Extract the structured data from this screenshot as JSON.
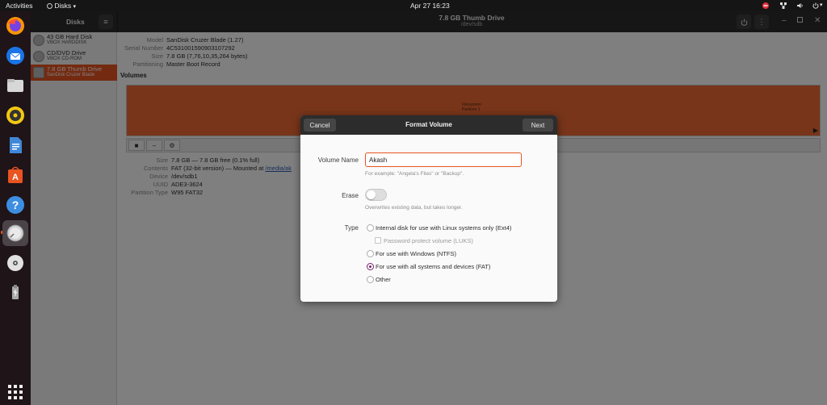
{
  "topbar": {
    "activities": "Activities",
    "app_menu": "Disks",
    "clock": "Apr 27  16:23"
  },
  "dock": {
    "items": [
      {
        "name": "firefox",
        "icon": "firefox-icon"
      },
      {
        "name": "thunderbird",
        "icon": "mail-icon"
      },
      {
        "name": "files",
        "icon": "folder-icon"
      },
      {
        "name": "rhythmbox",
        "icon": "music-icon"
      },
      {
        "name": "libreoffice-writer",
        "icon": "document-icon"
      },
      {
        "name": "software",
        "icon": "app-store-icon"
      },
      {
        "name": "help",
        "icon": "help-icon"
      },
      {
        "name": "disks",
        "icon": "disks-icon",
        "active": true
      },
      {
        "name": "cd-drive",
        "icon": "disc-icon"
      },
      {
        "name": "usb-drive",
        "icon": "usb-icon"
      },
      {
        "name": "show-applications",
        "icon": "grid-icon"
      }
    ]
  },
  "header": {
    "sidebar_title": "Disks",
    "title": "7.8 GB Thumb Drive",
    "subtitle": "/dev/sdb"
  },
  "sidebar": {
    "drives": [
      {
        "name": "43 GB Hard Disk",
        "sub": "VBOX HARDDISK"
      },
      {
        "name": "CD/DVD Drive",
        "sub": "VBOX CD-ROM"
      },
      {
        "name": "7.8 GB Thumb Drive",
        "sub": "SanDisk Cruzer Blade",
        "selected": true
      }
    ]
  },
  "drive_info": {
    "model_label": "Model",
    "model": "SanDisk Cruzer Blade (1.27)",
    "serial_label": "Serial Number",
    "serial": "4C531001590903107292",
    "size_label": "Size",
    "size": "7.8 GB (7,76,10,35,264 bytes)",
    "partitioning_label": "Partitioning",
    "partitioning": "Master Boot Record"
  },
  "volumes": {
    "heading": "Volumes",
    "bar_text_1": "Filesystem",
    "bar_text_2": "Partition 1"
  },
  "partition_info": {
    "size_label": "Size",
    "size": "7.8 GB — 7.8 GB free (0.1% full)",
    "contents_label": "Contents",
    "contents": "FAT (32-bit version) — Mounted at ",
    "mount_link": "/media/ak",
    "device_label": "Device",
    "device": "/dev/sdb1",
    "uuid_label": "UUID",
    "uuid": "ADE3-3624",
    "ptype_label": "Partition Type",
    "ptype": "W95 FAT32"
  },
  "dialog": {
    "title": "Format Volume",
    "cancel_label": "Cancel",
    "next_label": "Next",
    "volume_name_label": "Volume Name",
    "volume_name_value": "Akash",
    "volume_name_hint": "For example: \"Angela's Files\" or \"Backup\".",
    "erase_label": "Erase",
    "erase_on": false,
    "erase_hint": "Overwrites existing data, but takes longer.",
    "type_label": "Type",
    "options": [
      "Internal disk for use with Linux systems only (Ext4)",
      "Password protect volume (LUKS)",
      "For use with Windows (NTFS)",
      "For use with all systems and devices (FAT)",
      "Other"
    ],
    "selected_option": "For use with all systems and devices (FAT)"
  },
  "colors": {
    "accent": "#e95420",
    "radio_selected": "#77216f",
    "header_dark": "#2c2c2c"
  }
}
